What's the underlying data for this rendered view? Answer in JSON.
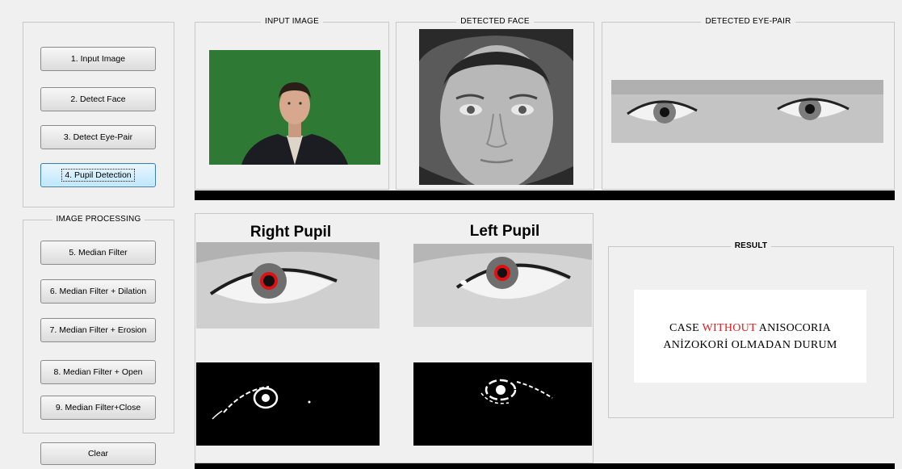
{
  "controls": {
    "buttons": [
      {
        "label": "1. Input Image"
      },
      {
        "label": "2. Detect Face"
      },
      {
        "label": "3. Detect Eye-Pair"
      },
      {
        "label": "4. Pupil Detection"
      }
    ]
  },
  "image_processing": {
    "title": "IMAGE PROCESSING",
    "buttons": [
      {
        "label": "5. Median Filter"
      },
      {
        "label": "6. Median Filter + Dilation"
      },
      {
        "label": "7. Median Filter + Erosion"
      },
      {
        "label": "8. Median Filter + Open"
      },
      {
        "label": "9. Median Filter+Close"
      }
    ]
  },
  "clear_button": {
    "label": "Clear"
  },
  "panels": {
    "input_image": {
      "title": "INPUT IMAGE"
    },
    "detected_face": {
      "title": "DETECTED FACE"
    },
    "detected_eye_pair": {
      "title": "DETECTED EYE-PAIR"
    }
  },
  "pupils": {
    "right_title": "Right Pupil",
    "left_title": "Left Pupil"
  },
  "result": {
    "title": "RESULT",
    "line1_prefix": "CASE ",
    "line1_highlight": "WITHOUT",
    "line1_suffix": " ANISOCORIA",
    "line2": "ANİZOKORİ OLMADAN DURUM",
    "highlight_color": "#e02020"
  },
  "colors": {
    "green_screen": "#2e7a34",
    "pupil_marker": "#e01010"
  }
}
